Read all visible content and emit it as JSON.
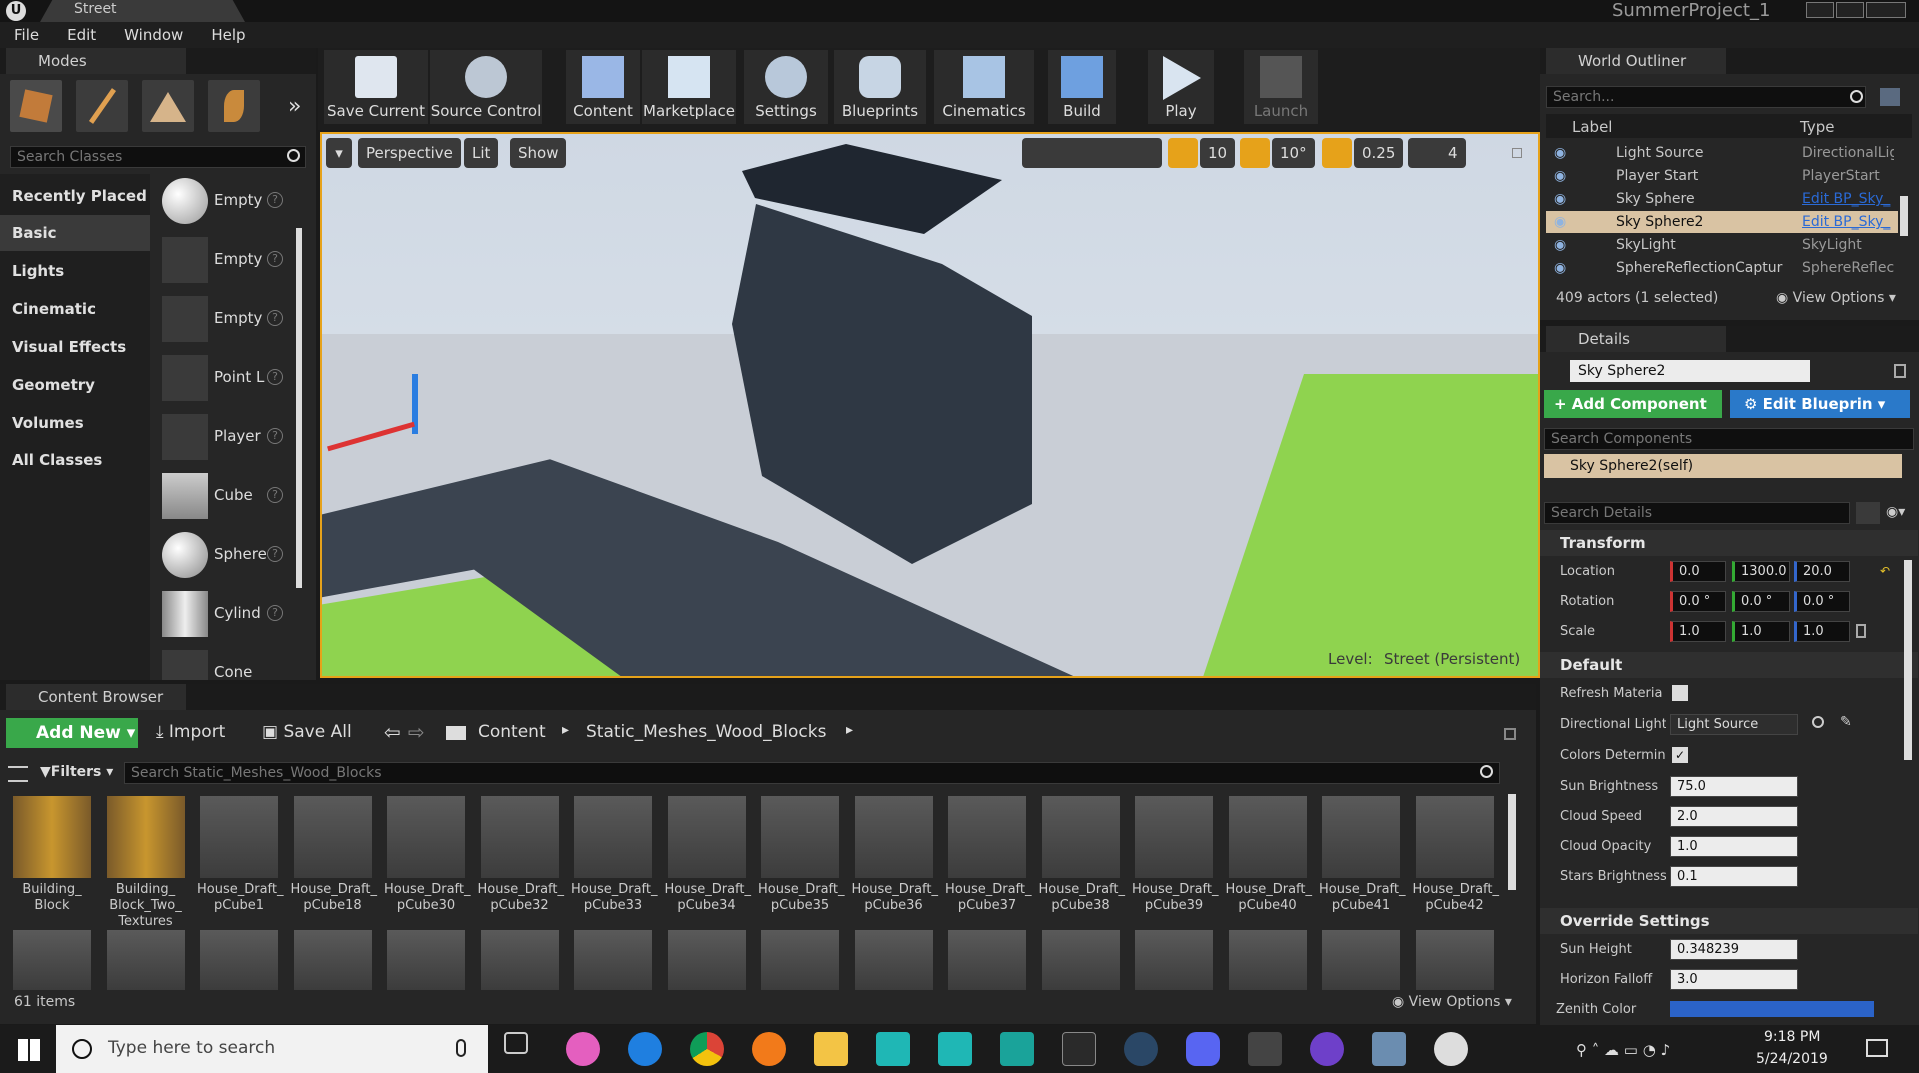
{
  "window": {
    "tab": "Street",
    "project": "SummerProject_1"
  },
  "menu": [
    "File",
    "Edit",
    "Window",
    "Help"
  ],
  "modes": {
    "tab": "Modes",
    "search_placeholder": "Search Classes",
    "categories": [
      "Recently Placed",
      "Basic",
      "Lights",
      "Cinematic",
      "Visual Effects",
      "Geometry",
      "Volumes",
      "All Classes"
    ],
    "selected_category": "Basic",
    "items": [
      "Empty",
      "Empty",
      "Empty",
      "Point L",
      "Player",
      "Cube",
      "Sphere",
      "Cylind",
      "Cone"
    ]
  },
  "toolbar": [
    "Save Current",
    "Source Control",
    "Content",
    "Marketplace",
    "Settings",
    "Blueprints",
    "Cinematics",
    "Build",
    "Play",
    "Launch"
  ],
  "viewport": {
    "perspective": "Perspective",
    "lit": "Lit",
    "show": "Show",
    "grid": "10",
    "angle": "10°",
    "scale": "0.25",
    "speed": "4",
    "level_label": "Level:",
    "level_value": "Street (Persistent)"
  },
  "outliner": {
    "tab": "World Outliner",
    "search_placeholder": "Search...",
    "col_label": "Label",
    "col_type": "Type",
    "rows": [
      {
        "label": "Light Source",
        "type": "DirectionalLig",
        "link": false
      },
      {
        "label": "Player Start",
        "type": "PlayerStart",
        "link": false
      },
      {
        "label": "Sky Sphere",
        "type": "Edit BP_Sky_",
        "link": true
      },
      {
        "label": "Sky Sphere2",
        "type": "Edit BP_Sky_",
        "link": true
      },
      {
        "label": "SkyLight",
        "type": "SkyLight",
        "link": false
      },
      {
        "label": "SphereReflectionCaptur",
        "type": "SphereReflec",
        "link": false
      }
    ],
    "selected_row": 3,
    "footer": "409 actors (1 selected)",
    "view_options": "View Options"
  },
  "details": {
    "tab": "Details",
    "name": "Sky Sphere2",
    "add_component": "+ Add Component",
    "edit_blueprint": "Edit Blueprin",
    "search_components": "Search Components",
    "component": "Sky Sphere2(self)",
    "search_details": "Search Details",
    "transform": "Transform",
    "location_label": "Location",
    "location": [
      "0.0",
      "1300.0",
      "20.0"
    ],
    "rotation_label": "Rotation",
    "rotation": [
      "0.0 °",
      "0.0 °",
      "0.0 °"
    ],
    "scale_label": "Scale",
    "scale": [
      "1.0",
      "1.0",
      "1.0"
    ],
    "default": "Default",
    "refresh_label": "Refresh Materia",
    "dirlight_label": "Directional Light",
    "dirlight_value": "Light Source",
    "colors_label": "Colors Determin",
    "sun_brightness_label": "Sun Brightness",
    "sun_brightness": "75.0",
    "cloud_speed_label": "Cloud Speed",
    "cloud_speed": "2.0",
    "cloud_opacity_label": "Cloud Opacity",
    "cloud_opacity": "1.0",
    "stars_label": "Stars Brightness",
    "stars": "0.1",
    "override": "Override Settings",
    "sun_height_label": "Sun Height",
    "sun_height": "0.348239",
    "horizon_label": "Horizon Falloff",
    "horizon": "3.0",
    "zenith_label": "Zenith Color"
  },
  "content": {
    "tab": "Content Browser",
    "add_new": "Add New",
    "import": "Import",
    "save_all": "Save All",
    "path": [
      "Content",
      "Static_Meshes_Wood_Blocks"
    ],
    "filters": "Filters",
    "search_placeholder": "Search Static_Meshes_Wood_Blocks",
    "assets": [
      [
        "Building_",
        "Block"
      ],
      [
        "Building_",
        "Block_Two_",
        "Textures"
      ],
      [
        "House_Draft_",
        "pCube1"
      ],
      [
        "House_Draft_",
        "pCube18"
      ],
      [
        "House_Draft_",
        "pCube30"
      ],
      [
        "House_Draft_",
        "pCube32"
      ],
      [
        "House_Draft_",
        "pCube33"
      ],
      [
        "House_Draft_",
        "pCube34"
      ],
      [
        "House_Draft_",
        "pCube35"
      ],
      [
        "House_Draft_",
        "pCube36"
      ],
      [
        "House_Draft_",
        "pCube37"
      ],
      [
        "House_Draft_",
        "pCube38"
      ],
      [
        "House_Draft_",
        "pCube39"
      ],
      [
        "House_Draft_",
        "pCube40"
      ],
      [
        "House_Draft_",
        "pCube41"
      ],
      [
        "House_Draft_",
        "pCube42"
      ]
    ],
    "count": "61 items",
    "view_options": "View Options"
  },
  "taskbar": {
    "search": "Type here to search",
    "time": "9:18 PM",
    "date": "5/24/2019"
  }
}
